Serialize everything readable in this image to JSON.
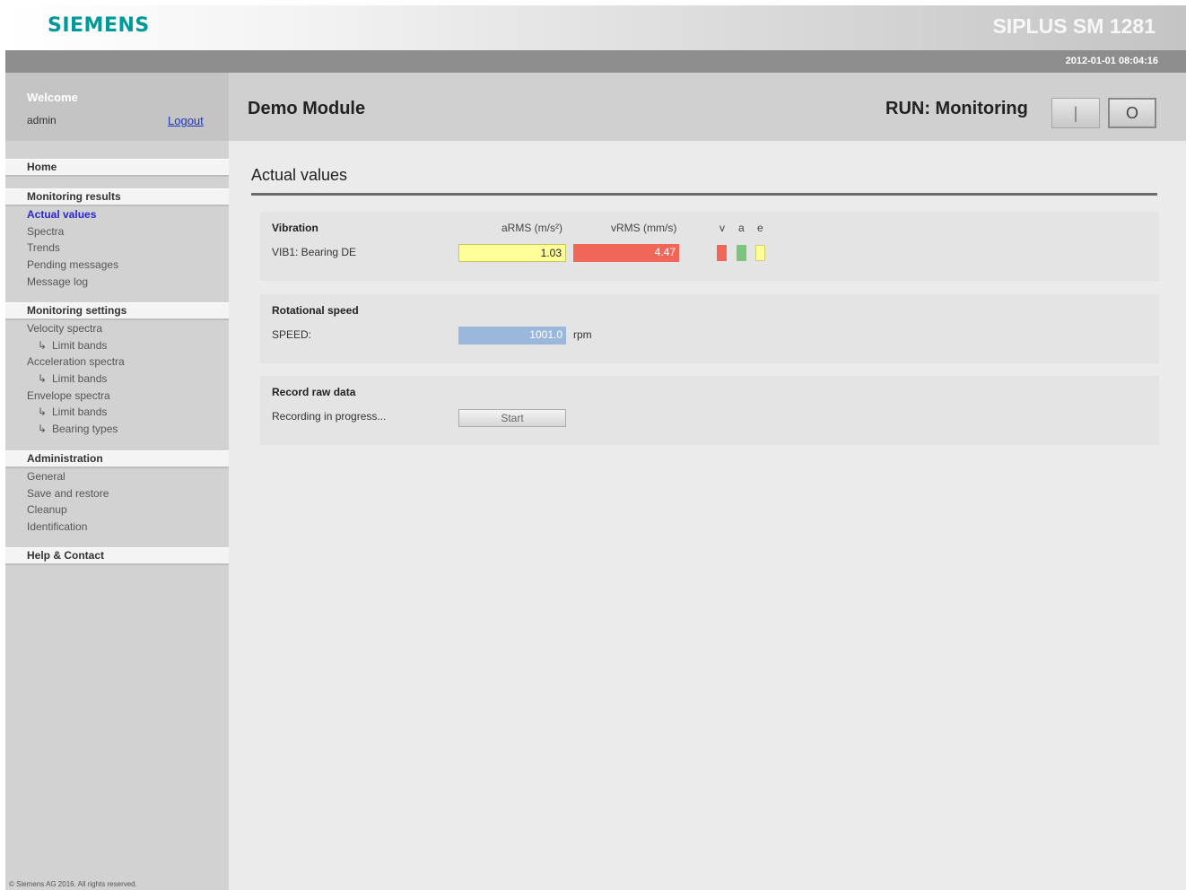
{
  "header": {
    "brand": "SIEMENS",
    "product": "SIPLUS SM 1281",
    "datetime": "2012-01-01 08:04:16"
  },
  "sidebar": {
    "welcome": "Welcome",
    "user": "admin",
    "logout": "Logout",
    "sections": [
      {
        "title": "Home",
        "items": []
      },
      {
        "title": "Monitoring results",
        "items": [
          {
            "label": "Actual values",
            "active": true
          },
          {
            "label": "Spectra"
          },
          {
            "label": "Trends"
          },
          {
            "label": "Pending messages"
          },
          {
            "label": "Message log"
          }
        ]
      },
      {
        "title": "Monitoring settings",
        "items": [
          {
            "label": "Velocity spectra"
          },
          {
            "label": "Limit bands",
            "sub": true
          },
          {
            "label": "Acceleration spectra"
          },
          {
            "label": "Limit bands",
            "sub": true
          },
          {
            "label": "Envelope spectra"
          },
          {
            "label": "Limit bands",
            "sub": true
          },
          {
            "label": "Bearing types",
            "sub": true
          }
        ]
      },
      {
        "title": "Administration",
        "items": [
          {
            "label": "General"
          },
          {
            "label": "Save and restore"
          },
          {
            "label": "Cleanup"
          },
          {
            "label": "Identification"
          }
        ]
      },
      {
        "title": "Help & Contact",
        "items": []
      }
    ],
    "copyright": "© Siemens AG 2016. All rights reserved."
  },
  "main": {
    "module_title": "Demo Module",
    "run_status": "RUN: Monitoring",
    "run_buttons": {
      "start": "|",
      "stop": "O"
    },
    "section_title": "Actual values",
    "vibration": {
      "title": "Vibration",
      "col_arms": "aRMS (m/s²)",
      "col_vrms": "vRMS (mm/s)",
      "col_v": "v",
      "col_a": "a",
      "col_e": "e",
      "row_label": "VIB1: Bearing DE",
      "arms_value": "1.03",
      "vrms_value": "4.47",
      "colors": {
        "arms_bg": "#ffff99",
        "vrms_bg": "#f0675a",
        "v": "#f0675a",
        "a": "#7cc47c",
        "e": "#ffff99"
      }
    },
    "speed": {
      "title": "Rotational speed",
      "label": "SPEED:",
      "value": "1001.0",
      "unit": "rpm",
      "color": "#9bb8dc"
    },
    "record": {
      "title": "Record raw data",
      "status": "Recording in progress...",
      "button": "Start"
    }
  }
}
